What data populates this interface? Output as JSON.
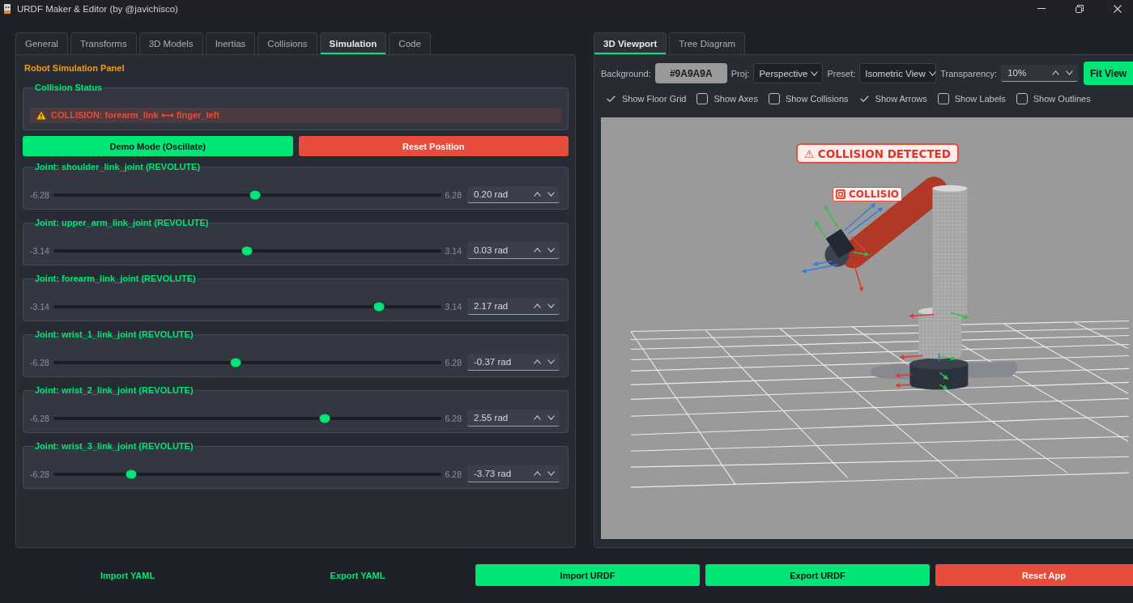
{
  "window": {
    "title": "URDF Maker & Editor (by @javichisco)"
  },
  "editor": {
    "tabs": [
      {
        "label": "General",
        "selected": false
      },
      {
        "label": "Transforms",
        "selected": false
      },
      {
        "label": "3D Models",
        "selected": false
      },
      {
        "label": "Inertias",
        "selected": false
      },
      {
        "label": "Collisions",
        "selected": false
      },
      {
        "label": "Simulation",
        "selected": true
      },
      {
        "label": "Code",
        "selected": false
      }
    ],
    "panel_title": "Robot Simulation Panel",
    "collision_status": {
      "title": "Collision Status",
      "message": "COLLISION: forearm_link ⟷ finger_left"
    },
    "actions": [
      {
        "label": "Demo Mode (Oscillate)",
        "kind": "primary"
      },
      {
        "label": "Reset Position",
        "kind": "danger"
      }
    ],
    "joints": [
      {
        "title": "Joint: shoulder_link_joint (REVOLUTE)",
        "min": "-6.28",
        "max": "6.28",
        "level": 0.52,
        "value": "0.20 rad"
      },
      {
        "title": "Joint: upper_arm_link_joint (REVOLUTE)",
        "min": "-3.14",
        "max": "3.14",
        "level": 0.5,
        "value": "0.03 rad"
      },
      {
        "title": "Joint: forearm_link_joint (REVOLUTE)",
        "min": "-3.14",
        "max": "3.14",
        "level": 0.84,
        "value": "2.17 rad"
      },
      {
        "title": "Joint: wrist_1_link_joint (REVOLUTE)",
        "min": "-6.28",
        "max": "6.28",
        "level": 0.47,
        "value": "-0.37 rad"
      },
      {
        "title": "Joint: wrist_2_link_joint (REVOLUTE)",
        "min": "-6.28",
        "max": "6.28",
        "level": 0.7,
        "value": "2.55 rad"
      },
      {
        "title": "Joint: wrist_3_link_joint (REVOLUTE)",
        "min": "-6.28",
        "max": "6.28",
        "level": 0.2,
        "value": "-3.73 rad"
      }
    ]
  },
  "viewer": {
    "tabs": [
      {
        "label": "3D Viewport",
        "selected": true
      },
      {
        "label": "Tree Diagram",
        "selected": false
      }
    ],
    "toolbar": {
      "background_label": "Background:",
      "background_value": "#9A9A9A",
      "projection_label": "Proj:",
      "projection": "Perspective",
      "preset_label": "Preset:",
      "preset": "Isometric View",
      "transparency_label": "Transparency:",
      "transparency": "10%",
      "fit_button": "Fit View"
    },
    "options": [
      {
        "label": "Show Floor Grid",
        "checked": true
      },
      {
        "label": "Show Axes",
        "checked": false
      },
      {
        "label": "Show Collisions",
        "checked": false
      },
      {
        "label": "Show Arrows",
        "checked": true
      },
      {
        "label": "Show Labels",
        "checked": false
      },
      {
        "label": "Show Outlines",
        "checked": false
      }
    ],
    "scene_labels": [
      {
        "text": "⚠ COLLISION DETECTED",
        "kind": "banner"
      },
      {
        "text": "COLLISIO",
        "kind": "tag"
      }
    ]
  },
  "footer_buttons": [
    {
      "label": "Import YAML",
      "kind": "outline"
    },
    {
      "label": "Export YAML",
      "kind": "outline"
    },
    {
      "label": "Import URDF",
      "kind": "primary"
    },
    {
      "label": "Export URDF",
      "kind": "primary"
    },
    {
      "label": "Reset App",
      "kind": "danger"
    }
  ]
}
